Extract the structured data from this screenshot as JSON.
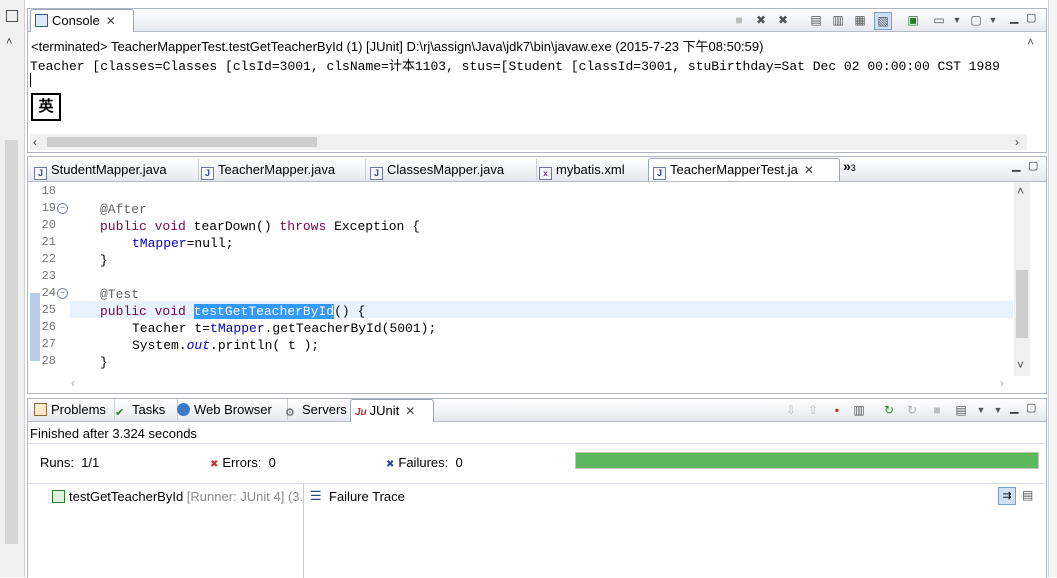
{
  "console": {
    "tab_label": "Console",
    "status_line": "<terminated> TeacherMapperTest.testGetTeacherById (1) [JUnit] D:\\rj\\assign\\Java\\jdk7\\bin\\javaw.exe (2015-7-23 下午08:50:59)",
    "output_line": "Teacher [classes=Classes [clsId=3001, clsName=计本1103, stus=[Student [classId=3001, stuBirthday=Sat Dec 02 00:00:00 CST 1989",
    "ime_badge": "英"
  },
  "editor": {
    "tabs": [
      {
        "label": "StudentMapper.java",
        "type": "java"
      },
      {
        "label": "TeacherMapper.java",
        "type": "java"
      },
      {
        "label": "ClassesMapper.java",
        "type": "java"
      },
      {
        "label": "mybatis.xml",
        "type": "xml"
      },
      {
        "label": "TeacherMapperTest.ja",
        "type": "java",
        "active": true
      }
    ],
    "overflow_label": "»",
    "overflow_count": "3",
    "lines": [
      {
        "n": "18"
      },
      {
        "n": "19"
      },
      {
        "n": "20"
      },
      {
        "n": "21"
      },
      {
        "n": "22"
      },
      {
        "n": "23"
      },
      {
        "n": "24"
      },
      {
        "n": "25"
      },
      {
        "n": "26"
      },
      {
        "n": "27"
      },
      {
        "n": "28"
      }
    ],
    "code": {
      "l19": "@After",
      "l20_kw1": "public",
      "l20_kw2": "void",
      "l20_rest1": " tearDown() ",
      "l20_kw3": "throws",
      "l20_rest2": " Exception {",
      "l21_field": "tMapper",
      "l21_rest": "=null;",
      "l22": "}",
      "l24": "@Test",
      "l25_kw1": "public",
      "l25_kw2": "void",
      "l25_sel": "testGetTeacherById",
      "l25_rest": "() {",
      "l26_a": "Teacher t=",
      "l26_field": "tMapper",
      "l26_b": ".getTeacherById(5001);",
      "l27_a": "System.",
      "l27_out": "out",
      "l27_b": ".println( t );",
      "l28": "}"
    }
  },
  "bottom": {
    "tabs": [
      {
        "label": "Problems"
      },
      {
        "label": "Tasks"
      },
      {
        "label": "Web Browser"
      },
      {
        "label": "Servers"
      },
      {
        "label": "JUnit",
        "active": true
      }
    ],
    "finished": "Finished after 3.324 seconds",
    "runs_label": "Runs:",
    "runs_value": "1/1",
    "errors_label": "Errors:",
    "errors_value": "0",
    "failures_label": "Failures:",
    "failures_value": "0",
    "progress": 1.0,
    "progress_color": "#5cb85c",
    "test_name": "testGetTeacherById",
    "test_runner": "[Runner: JUnit 4] (3.",
    "failure_trace_label": "Failure Trace"
  }
}
